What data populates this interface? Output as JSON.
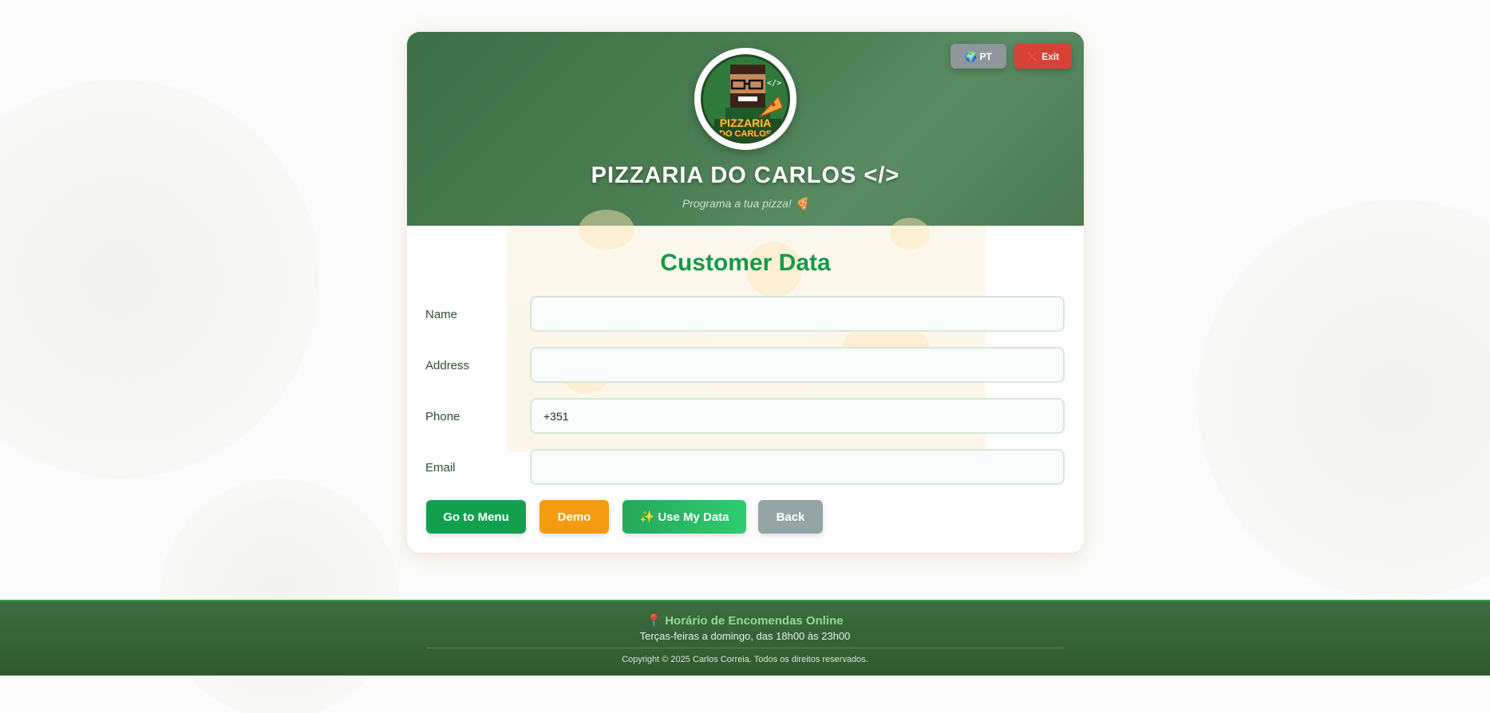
{
  "header": {
    "title": "PIZZARIA DO CARLOS </>",
    "subtitle": "Programa a tua pizza! 🍕",
    "lang_button": "🌍 PT",
    "exit_button": "❌ Exit",
    "logo_text_top": "PIZZARIA",
    "logo_text_bottom": "DO CARLOS"
  },
  "form": {
    "section_title": "Customer Data",
    "fields": [
      {
        "label": "Name",
        "value": ""
      },
      {
        "label": "Address",
        "value": ""
      },
      {
        "label": "Phone",
        "value": "+351"
      },
      {
        "label": "Email",
        "value": ""
      }
    ]
  },
  "actions": {
    "go_to_menu": "Go to Menu",
    "demo": "Demo",
    "use_my_data": "✨ Use My Data",
    "back": "Back"
  },
  "footer": {
    "title": "📍 Horário de Encomendas Online",
    "hours": "Terças-feiras a domingo, das 18h00 às 23h00",
    "copyright": "Copyright © 2025 Carlos Correia. Todos os direitos reservados."
  },
  "colors": {
    "header_green": "#4a7d52",
    "accent_green": "#16994a",
    "primary_button": "#12a04f",
    "demo_button": "#f39c12",
    "use_data_button": "#27ae60",
    "back_button": "#95a5a6",
    "exit_button": "#d84236",
    "lang_button": "#8f979b"
  }
}
